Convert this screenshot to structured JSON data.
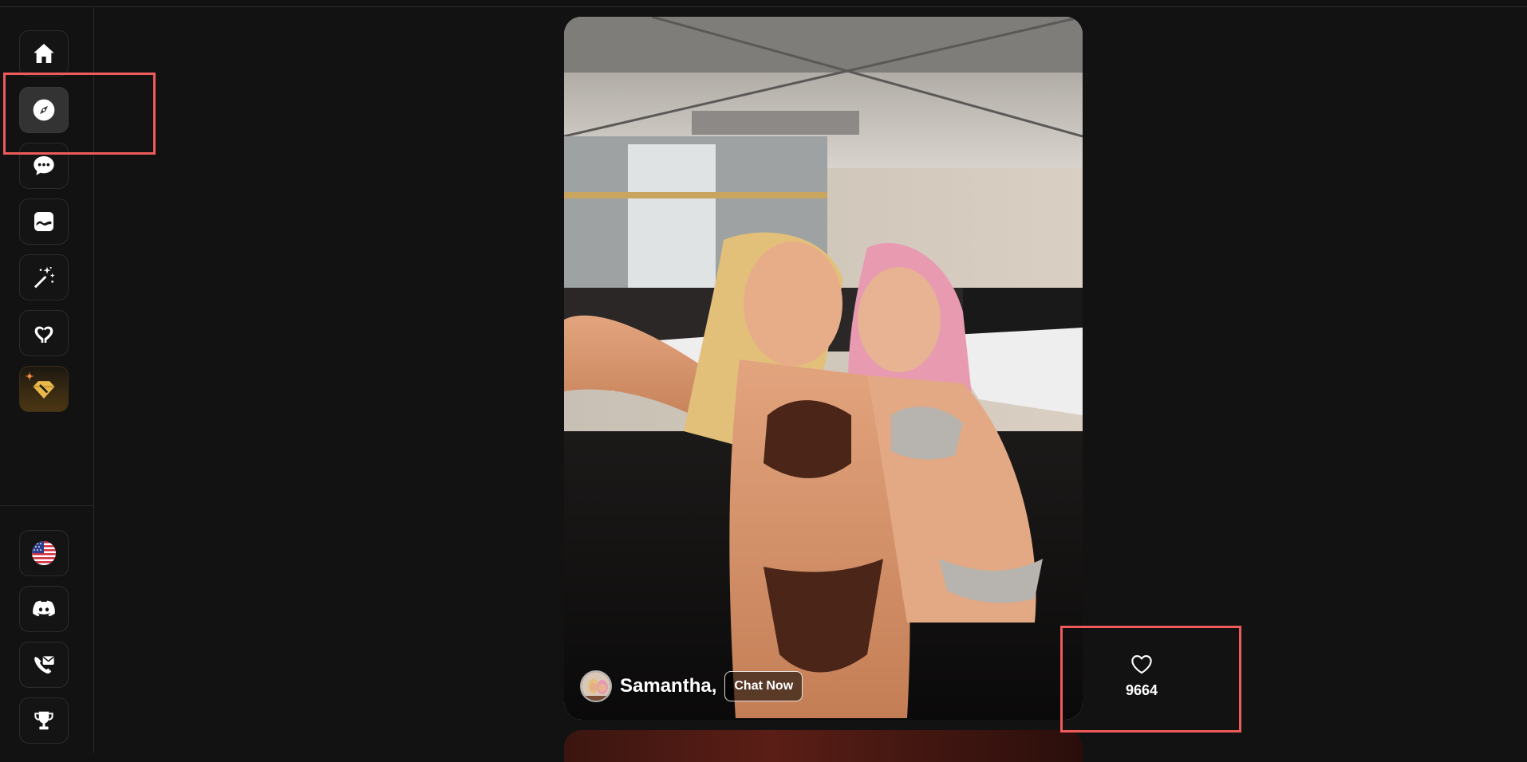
{
  "sidebar": {
    "top_items": [
      {
        "id": "home",
        "icon": "home-icon"
      },
      {
        "id": "explore",
        "icon": "compass-icon",
        "active": true
      },
      {
        "id": "chat",
        "icon": "chat-bubble-icon"
      },
      {
        "id": "gallery",
        "icon": "image-icon"
      },
      {
        "id": "generate",
        "icon": "magic-wand-icon"
      },
      {
        "id": "my-ai",
        "icon": "heart-hands-icon"
      },
      {
        "id": "premium",
        "icon": "diamond-icon"
      }
    ],
    "bottom_items": [
      {
        "id": "language",
        "icon": "us-flag-icon"
      },
      {
        "id": "discord",
        "icon": "discord-icon"
      },
      {
        "id": "contact",
        "icon": "mail-phone-icon"
      },
      {
        "id": "leaderboard",
        "icon": "trophy-icon"
      }
    ]
  },
  "feed": {
    "card": {
      "character_name": "Samantha,",
      "chat_button_label": "Chat Now",
      "avatar_icon": "character-avatar"
    },
    "like": {
      "icon": "heart-outline-icon",
      "count": "9664"
    }
  },
  "colors": {
    "background": "#121212",
    "sidebar_active": "#333333",
    "highlight": "#ef5a5a",
    "premium_gold": "#e8b84a"
  }
}
